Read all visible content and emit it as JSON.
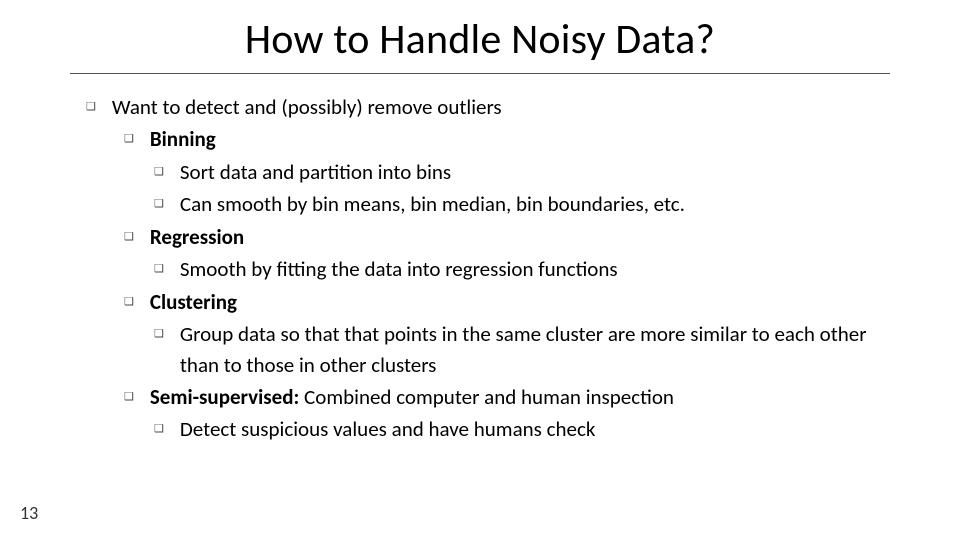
{
  "title": "How to Handle Noisy Data?",
  "page_number": "13",
  "bullets": {
    "intro": "Want to detect and (possibly) remove outliers",
    "binning": "Binning",
    "binning_sort": "Sort data and partition into bins",
    "binning_smooth": "Can smooth by bin means, bin median, bin boundaries, etc.",
    "regression": "Regression",
    "regression_sub": "Smooth by fitting the data into regression functions",
    "clustering": "Clustering",
    "clustering_sub": "Group data so that that points in the same cluster are more similar to each other than to those in other clusters",
    "semi_label": "Semi-supervised:",
    "semi_rest": " Combined computer and human inspection",
    "semi_sub": "Detect suspicious values and have humans check"
  }
}
